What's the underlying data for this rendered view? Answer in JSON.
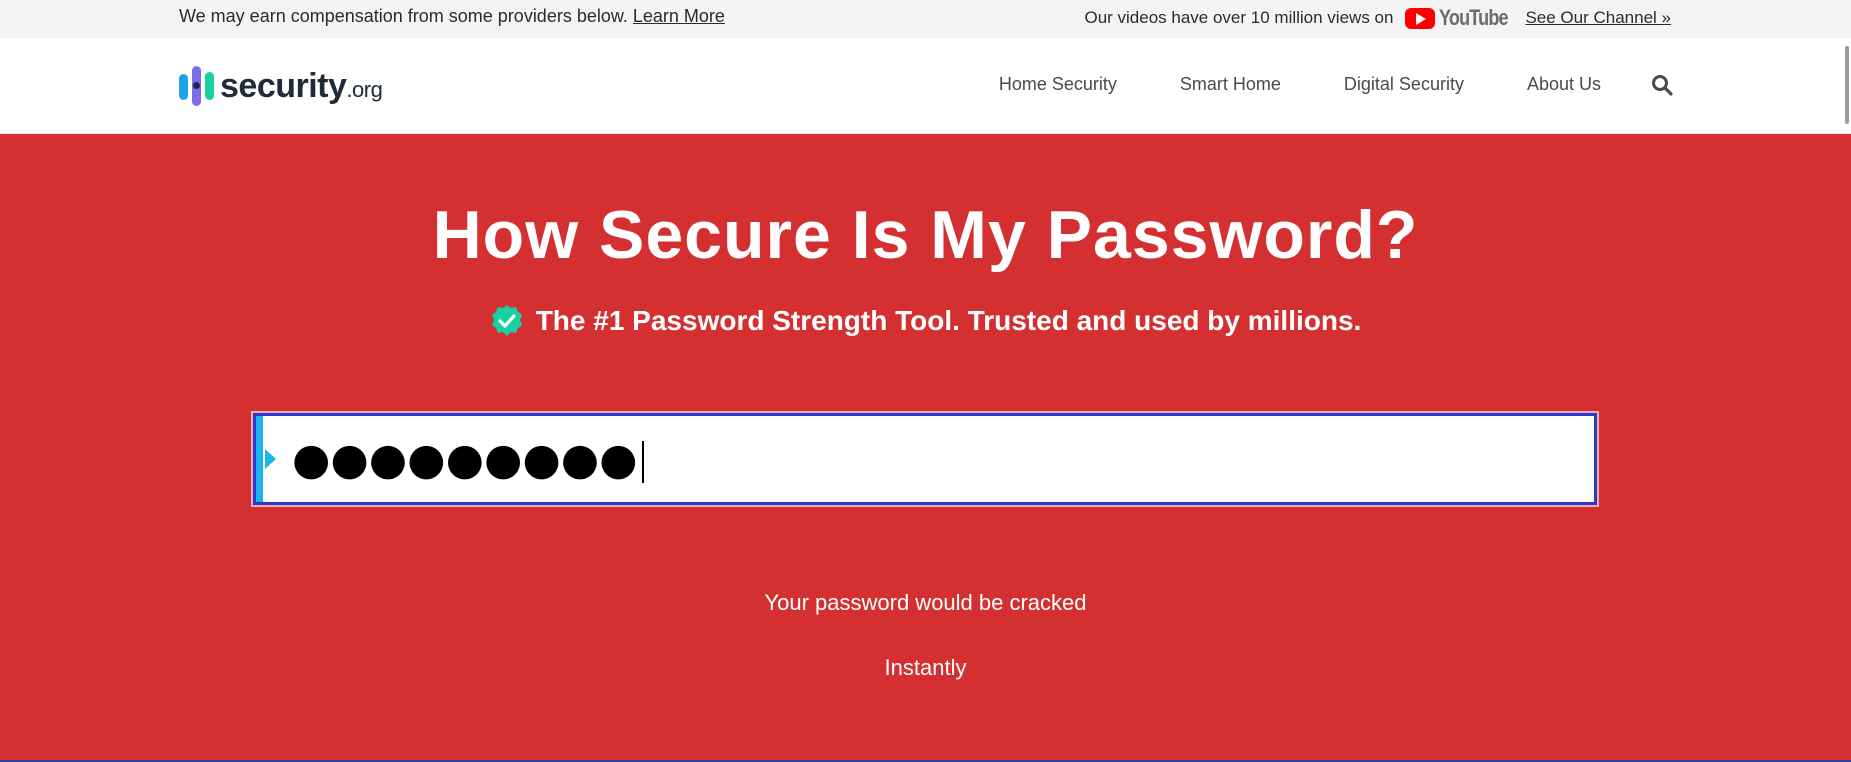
{
  "topbar": {
    "disclaimer": "We may earn compensation from some providers below.",
    "learn_more": "Learn More",
    "videos_text": "Our videos have over 10 million views on",
    "youtube_label": "YouTube",
    "channel_link": "See Our Channel »"
  },
  "header": {
    "logo_text": "security",
    "logo_suffix": ".org",
    "nav": [
      "Home Security",
      "Smart Home",
      "Digital Security",
      "About Us"
    ]
  },
  "hero": {
    "title": "How Secure Is My Password?",
    "subtitle": "The #1 Password Strength Tool. Trusted and used by millions."
  },
  "password": {
    "masked_value": "●●●●●●●●●"
  },
  "result": {
    "line": "Your password would be cracked",
    "time": "Instantly"
  },
  "colors": {
    "hero_bg": "#d53031",
    "accent": "#1cb4ef",
    "badge": "#18d1a3",
    "input_border": "#2a3ad0"
  }
}
